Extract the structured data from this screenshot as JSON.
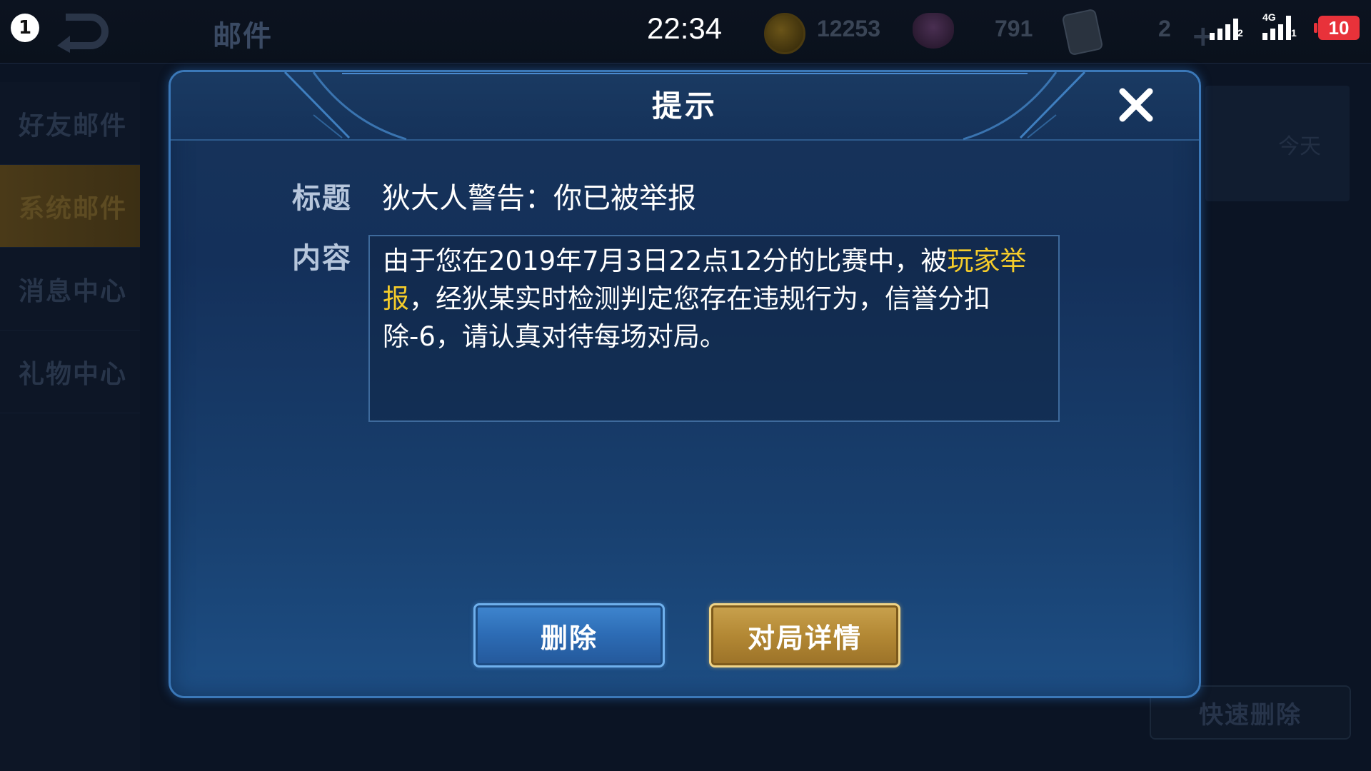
{
  "status_bar": {
    "notification_count": "1",
    "time": "22:34",
    "gold": "12253",
    "gems": "791",
    "tickets": "2",
    "network_label": "4G",
    "sim1_tag": "2",
    "sim2_tag": "1",
    "battery": "10",
    "battery_color": "#e8323a"
  },
  "header": {
    "title": "邮件"
  },
  "sidebar": {
    "items": [
      {
        "label": "好友邮件"
      },
      {
        "label": "系统邮件",
        "active": true
      },
      {
        "label": "消息中心"
      },
      {
        "label": "礼物中心"
      }
    ]
  },
  "mail_list": {
    "date_label": "今天",
    "quick_delete_label": "快速删除"
  },
  "dialog": {
    "title": "提示",
    "subject_label": "标题",
    "subject": "狄大人警告：你已被举报",
    "content_label": "内容",
    "content_part1": "由于您在2019年7月3日22点12分的比赛中，被",
    "content_highlight": "玩家举报",
    "content_part2": "，经狄某实时检测判定您存在违规行为，信誉分扣除-6，请认真对待每场对局。",
    "highlight_color": "#f5cc2a",
    "delete_button": "删除",
    "detail_button": "对局详情"
  }
}
